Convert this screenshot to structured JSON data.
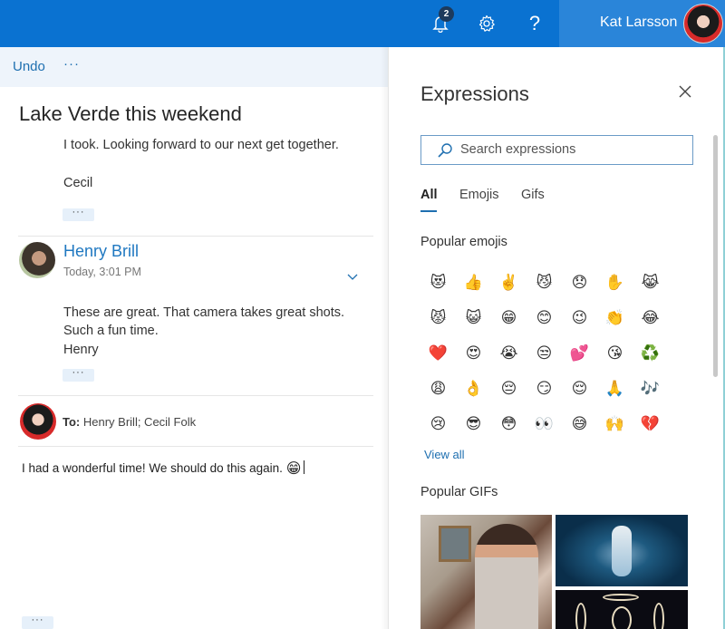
{
  "topbar": {
    "notification_count": "2",
    "help_label": "?",
    "user_name": "Kat Larsson",
    "background_color": "#0a72d1"
  },
  "toolbar": {
    "undo_label": "Undo",
    "more_label": "···"
  },
  "thread": {
    "subject": "Lake Verde this weekend",
    "messages": [
      {
        "sender": "Cecil",
        "body_lines": [
          "I took. Looking forward to our next get together.",
          "Cecil"
        ],
        "ellipsis": "···"
      },
      {
        "sender": "Henry Brill",
        "timestamp": "Today, 3:01 PM",
        "body_lines": [
          "These are great. That camera takes great shots.",
          "Such a fun time.",
          "Henry"
        ],
        "ellipsis": "···"
      }
    ],
    "reply": {
      "to_label": "To:",
      "recipients": "Henry Brill; Cecil Folk",
      "body": "I had a wonderful time!  We should do this again.",
      "inline_emoji": "😁",
      "bottom_ellipsis": "···"
    }
  },
  "expressions": {
    "title": "Expressions",
    "search_placeholder": "Search expressions",
    "tabs": [
      {
        "label": "All",
        "active": true
      },
      {
        "label": "Emojis",
        "active": false
      },
      {
        "label": "Gifs",
        "active": false
      }
    ],
    "popular_emojis_label": "Popular emojis",
    "emojis": [
      "😻",
      "👍",
      "✌️",
      "😼",
      "😞",
      "✋",
      "😹",
      "😾",
      "😺",
      "😁",
      "😊",
      "😉",
      "👏",
      "😂",
      "❤️",
      "😍",
      "😭",
      "😒",
      "💕",
      "😘",
      "♻️",
      "😩",
      "👌",
      "😔",
      "😏",
      "😌",
      "🙏",
      "🎶",
      "😢",
      "😎",
      "😳",
      "👀",
      "😅",
      "🙌",
      "💔"
    ],
    "view_all_label": "View all",
    "popular_gifs_label": "Popular GIFs",
    "gifs": [
      "man-dancing-gif",
      "underwater-performer-gif",
      "glowing-rings-gif"
    ]
  }
}
